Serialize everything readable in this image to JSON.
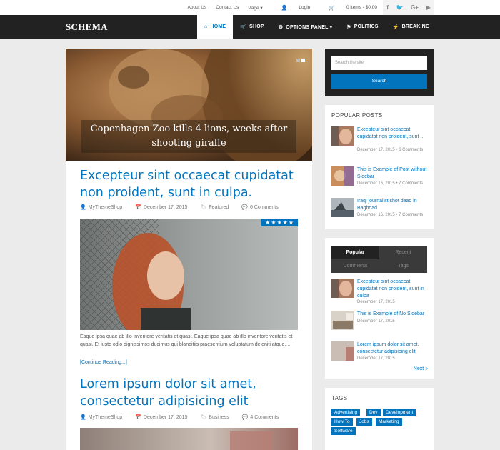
{
  "top_links": {
    "about": "About Us",
    "contact": "Contact Us",
    "page": "Page ▾",
    "login": "Login",
    "cart": "0 items - $0.00"
  },
  "social_icons": [
    "facebook-icon",
    "twitter-icon",
    "google-plus-icon",
    "youtube-icon"
  ],
  "header": {
    "logo": "SCHEMA",
    "nav": [
      {
        "label": "HOME",
        "icon": "home-icon",
        "active": true
      },
      {
        "label": "SHOP",
        "icon": "cart-icon"
      },
      {
        "label": "OPTIONS PANEL ▾",
        "icon": "gears-icon"
      },
      {
        "label": "POLITICS",
        "icon": "flag-icon"
      },
      {
        "label": "BREAKING",
        "icon": "bolt-icon"
      }
    ]
  },
  "slider": {
    "caption": "Copenhagen Zoo kills 4 lions, weeks after shooting giraffe"
  },
  "posts": [
    {
      "title": "Excepteur sint occaecat cupidatat non proident, sunt in culpa.",
      "author": "MyThemeShop",
      "date": "December 17, 2015",
      "category": "Featured",
      "comments": "6 Comments",
      "rating": "★★★★★",
      "excerpt": "Eaque ipsa quae ab illo inventore veritatis et quasi. Eaque ipsa quae ab illo inventore veritatis et quasi. Et iusto odio dignissimos ducimus qui blanditiis praesentium voluptatum deleniti atque. ..",
      "read_more": "[Continue Reading...]"
    },
    {
      "title": "Lorem ipsum dolor sit amet, consectetur adipisicing elit",
      "author": "MyThemeShop",
      "date": "December 17, 2015",
      "category": "Business",
      "comments": "4 Comments"
    }
  ],
  "sidebar": {
    "search": {
      "placeholder": "Search the site",
      "button": "Search"
    },
    "popular_posts": {
      "title": "POPULAR POSTS",
      "items": [
        {
          "title": "Excepteur sint occaecat cupidatat non proident, sunt ..",
          "meta": "December 17, 2015 • 6 Comments"
        },
        {
          "title": "This is Example of Post without Sidebar",
          "meta": "December 16, 2015 • 7 Comments"
        },
        {
          "title": "Iraqi journalist shot dead in Baghdad",
          "meta": "December 16, 2015 • 7 Comments"
        }
      ]
    },
    "tab_widget": {
      "tabs": [
        "Popular",
        "Recent",
        "Comments",
        "Tags"
      ],
      "items": [
        {
          "title": "Excepteur sint occaecat cupidatat non proident, sunt in culpa",
          "date": "December 17, 2015"
        },
        {
          "title": "This is Example of No Sidebar",
          "date": "December 17, 2015"
        },
        {
          "title": "Lorem ipsum dolor sit amet, consectetur adipisicing elit",
          "date": "December 17, 2015"
        }
      ],
      "next": "Next »"
    },
    "tags": {
      "title": "TAGS",
      "items": [
        "Advertising",
        "Dev",
        "Development",
        "How To",
        "Jobs",
        "Marketing",
        "Software"
      ]
    }
  },
  "colors": {
    "accent": "#0274be",
    "header_bg": "#222222",
    "page_bg": "#ebebeb"
  }
}
